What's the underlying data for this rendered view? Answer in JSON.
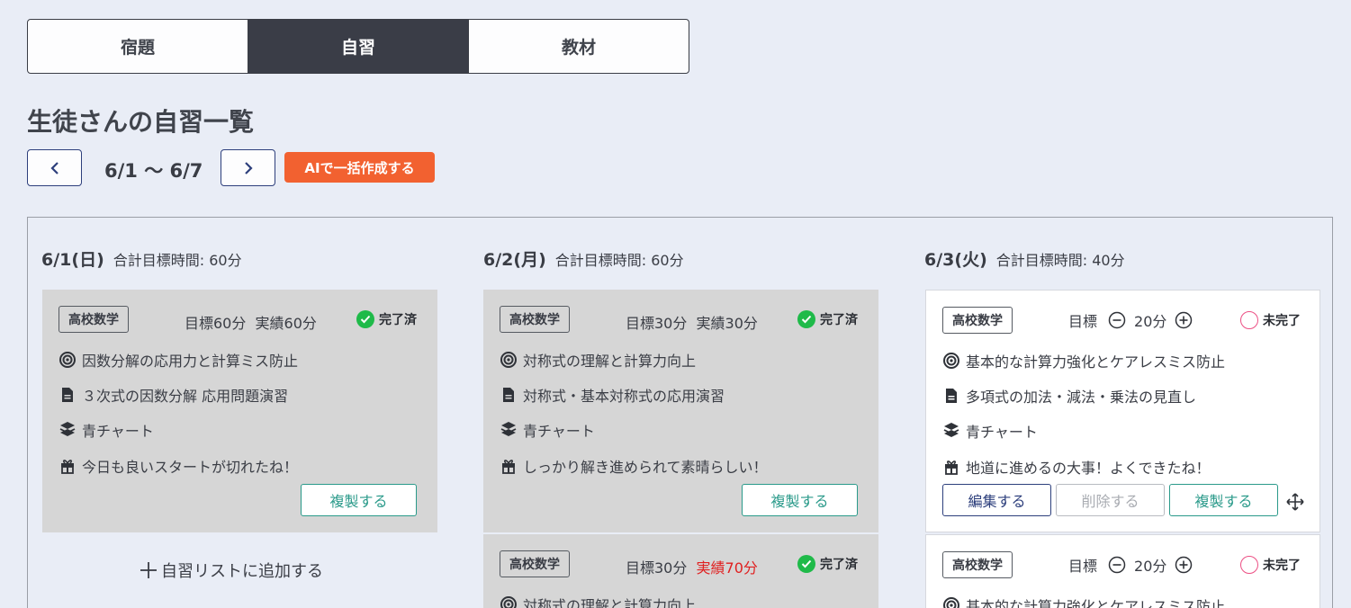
{
  "tabs": [
    {
      "label": "宿題",
      "active": false
    },
    {
      "label": "自習",
      "active": true
    },
    {
      "label": "教材",
      "active": false
    }
  ],
  "page_title": "生徒さんの自習一覧",
  "week": {
    "range": "6/1 〜 6/7",
    "ai_button": "AIで一括作成する"
  },
  "days": [
    {
      "date": "6/1(日)",
      "total": "合計目標時間: 60分"
    },
    {
      "date": "6/2(月)",
      "total": "合計目標時間: 60分"
    },
    {
      "date": "6/3(火)",
      "total": "合計目標時間: 40分"
    }
  ],
  "cards": [
    {
      "subject": "高校数学",
      "target": "目標60分",
      "actual": "実績60分",
      "status": "完了済",
      "goal": "因数分解の応用力と計算ミス防止",
      "content": "３次式の因数分解 応用問題演習",
      "material": "青チャート",
      "comment": "今日も良いスタートが切れたね！",
      "copy_label": "複製する"
    },
    {
      "subject": "高校数学",
      "target": "目標30分",
      "actual": "実績30分",
      "status": "完了済",
      "goal": "対称式の理解と計算力向上",
      "content": "対称式・基本対称式の応用演習",
      "material": "青チャート",
      "comment": "しっかり解き進められて素晴らしい！",
      "copy_label": "複製する"
    },
    {
      "subject": "高校数学",
      "target": "目標30分",
      "actual": "実績70分",
      "status": "完了済",
      "goal": "対称式の理解と計算力向上"
    },
    {
      "subject": "高校数学",
      "target_label": "目標",
      "minutes": "20分",
      "status": "未完了",
      "goal": "基本的な計算力強化とケアレスミス防止",
      "content": "多項式の加法・減法・乗法の見直し",
      "material": "青チャート",
      "comment": "地道に進めるの大事！よくできたね！",
      "edit_label": "編集する",
      "delete_label": "削除する",
      "copy_label": "複製する"
    },
    {
      "subject": "高校数学",
      "target_label": "目標",
      "minutes": "20分",
      "status": "未完了",
      "goal": "基本的な計算力強化とケアレスミス防止"
    }
  ],
  "add_label": "自習リストに追加する",
  "colors": {
    "accent_orange": "#f26130",
    "done_green": "#1fba49",
    "todo_pink": "#ec4f84",
    "navy": "#2d3f7c",
    "teal": "#2a9a8a",
    "red": "#e02020"
  }
}
